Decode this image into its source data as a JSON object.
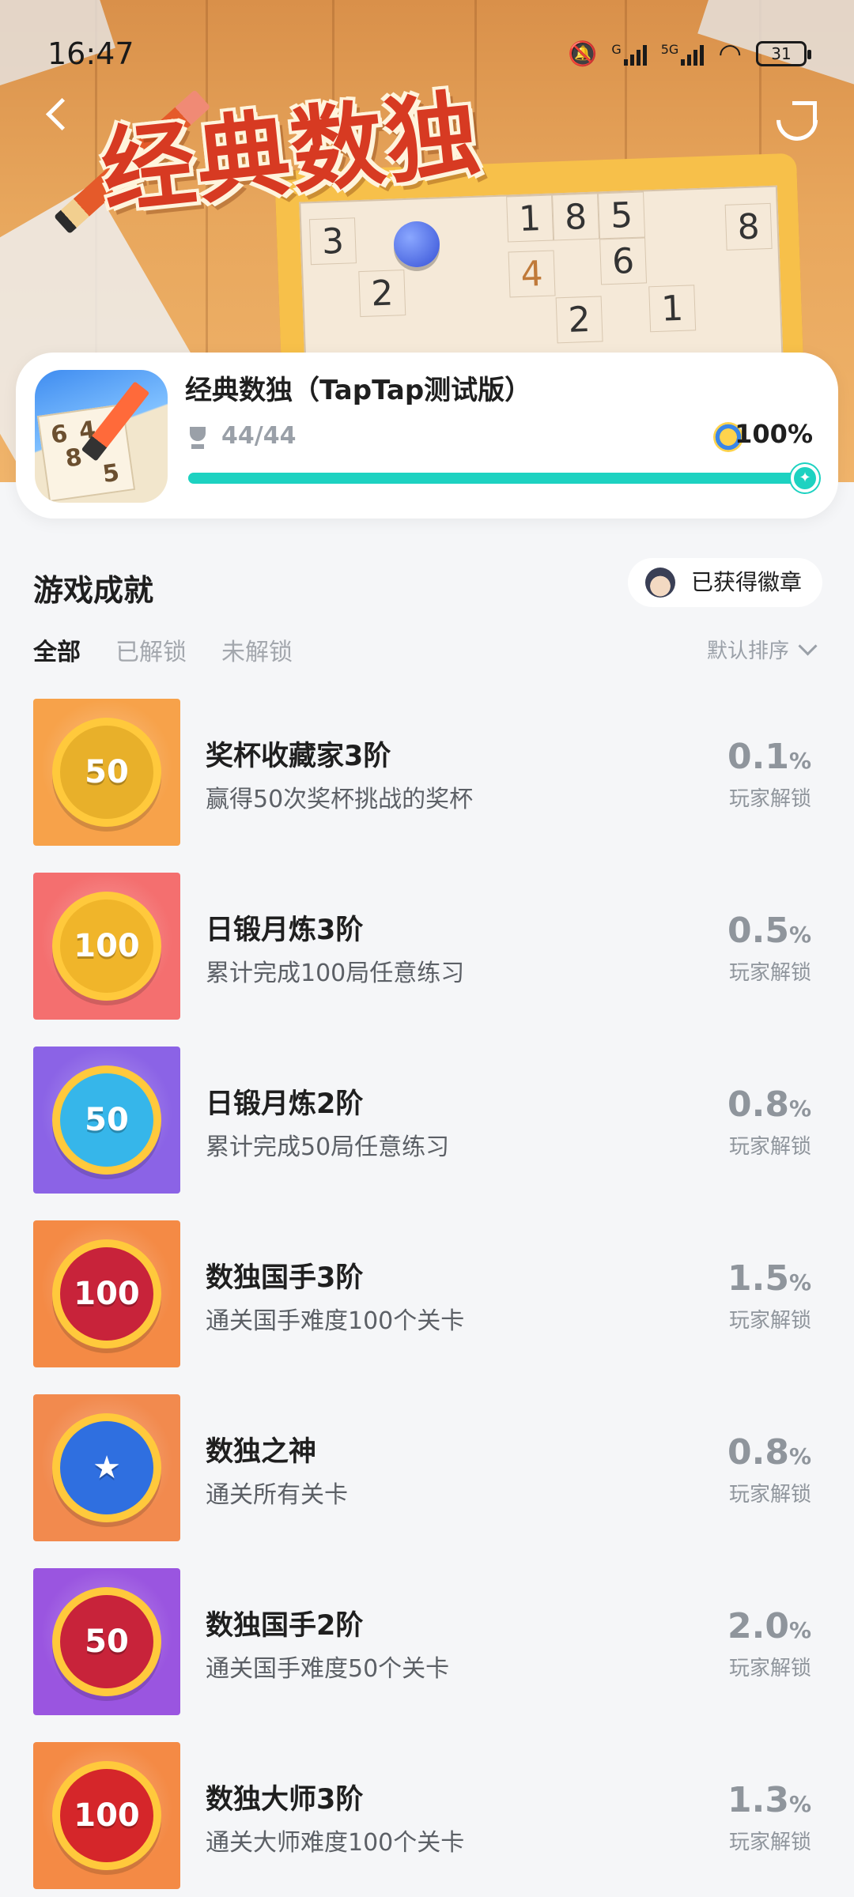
{
  "status_bar": {
    "time": "16:47",
    "battery": "31",
    "net1": "G",
    "net2": "5G"
  },
  "hero": {
    "title_art": "经典数独",
    "grid_numbers": [
      "3",
      "1",
      "8",
      "5",
      "8",
      "2",
      "4",
      "6",
      "2",
      "1"
    ]
  },
  "game": {
    "name": "经典数独（TapTap测试版）",
    "trophies": "44/44",
    "percent": "100%",
    "progress": 1.0
  },
  "section": {
    "title": "游戏成就",
    "earned_badges": "已获得徽章",
    "tabs": [
      "全部",
      "已解锁",
      "未解锁"
    ],
    "sort": "默认排序"
  },
  "achievements": [
    {
      "title": "奖杯收藏家3阶",
      "desc": "赢得50次奖杯挑战的奖杯",
      "rate": "0.1",
      "unit": "%",
      "unlock": "玩家解锁",
      "badge": "50",
      "icon": "trophy-icon",
      "bg": "#f7a24a",
      "emblem": "#e8b02a"
    },
    {
      "title": "日锻月炼3阶",
      "desc": "累计完成100局任意练习",
      "rate": "0.5",
      "unit": "%",
      "unlock": "玩家解锁",
      "badge": "100",
      "icon": "folder-icon",
      "bg": "#f46f6f",
      "emblem": "#f0b52a"
    },
    {
      "title": "日锻月炼2阶",
      "desc": "累计完成50局任意练习",
      "rate": "0.8",
      "unit": "%",
      "unlock": "玩家解锁",
      "badge": "50",
      "icon": "folder-icon",
      "bg": "#8b63e6",
      "emblem": "#36b6ea"
    },
    {
      "title": "数独国手3阶",
      "desc": "通关国手难度100个关卡",
      "rate": "1.5",
      "unit": "%",
      "unlock": "玩家解锁",
      "badge": "100",
      "icon": "medal-icon",
      "bg": "#f48a45",
      "emblem": "#c8233a"
    },
    {
      "title": "数独之神",
      "desc": "通关所有关卡",
      "rate": "0.8",
      "unit": "%",
      "unlock": "玩家解锁",
      "badge": "★",
      "icon": "star-badge-icon",
      "bg": "#f28a4e",
      "emblem": "#2f6fe0"
    },
    {
      "title": "数独国手2阶",
      "desc": "通关国手难度50个关卡",
      "rate": "2.0",
      "unit": "%",
      "unlock": "玩家解锁",
      "badge": "50",
      "icon": "medal-icon",
      "bg": "#9a55e0",
      "emblem": "#c8233a"
    },
    {
      "title": "数独大师3阶",
      "desc": "通关大师难度100个关卡",
      "rate": "1.3",
      "unit": "%",
      "unlock": "玩家解锁",
      "badge": "100",
      "icon": "medal-icon",
      "bg": "#f48a45",
      "emblem": "#d5262a"
    }
  ]
}
